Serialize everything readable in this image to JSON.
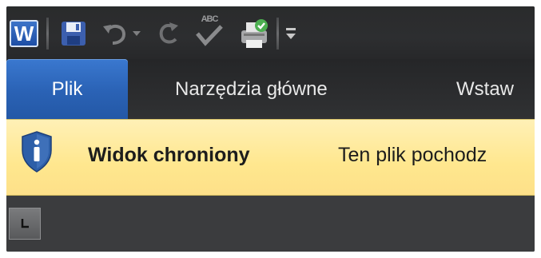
{
  "quick_access": {
    "app_logo_letter": "W",
    "spelling_icon_text": "ABC"
  },
  "tabs": [
    {
      "label": "Plik",
      "active": true
    },
    {
      "label": "Narzędzia główne",
      "active": false
    },
    {
      "label": "Wstaw",
      "active": false
    }
  ],
  "message_bar": {
    "title": "Widok chroniony",
    "text": "Ten plik pochodz"
  },
  "colors": {
    "file_tab": "#2a62b5",
    "message_bar": "#ffe78e",
    "shield": "#2d5fa8"
  }
}
